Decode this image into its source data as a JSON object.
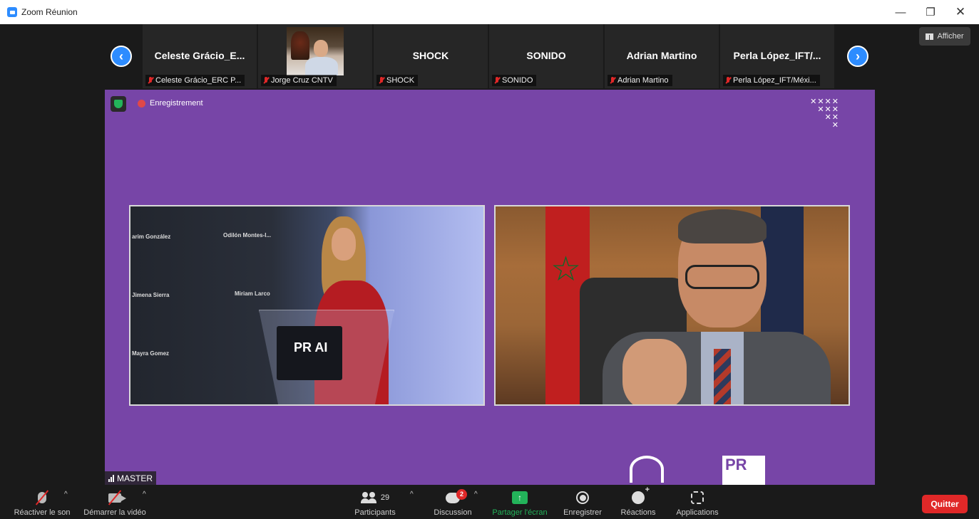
{
  "window": {
    "title": "Zoom Réunion"
  },
  "afficher_label": "Afficher",
  "thumbnails": [
    {
      "big": "Celeste Grácio_E...",
      "small": "Celeste Grácio_ERC P..."
    },
    {
      "big": "",
      "small": "Jorge Cruz CNTV"
    },
    {
      "big": "SHOCK",
      "small": "SHOCK"
    },
    {
      "big": "SONIDO",
      "small": "SONIDO"
    },
    {
      "big": "Adrian Martino",
      "small": "Adrian Martino"
    },
    {
      "big": "Perla López_IFT/...",
      "small": "Perla López_IFT/Méxi..."
    }
  ],
  "stage": {
    "recording_label": "Enregistrement",
    "master_label": "MASTER",
    "wall_names": [
      "arim González",
      "Odilón Montes-I...",
      "Jimena Sierra",
      "Miriam Larco",
      "Mayra Gomez"
    ],
    "podium_logo": "PR AI"
  },
  "toolbar": {
    "mic_label": "Réactiver le son",
    "video_label": "Démarrer la vidéo",
    "participants_label": "Participants",
    "participants_count": "29",
    "chat_label": "Discussion",
    "chat_badge": "2",
    "share_label": "Partager l'écran",
    "record_label": "Enregistrer",
    "reactions_label": "Réactions",
    "apps_label": "Applications",
    "quit_label": "Quitter"
  },
  "colors": {
    "stage_bg": "#7745a7",
    "accent_blue": "#2d8cff",
    "share_green": "#23b35a",
    "danger_red": "#e02828"
  }
}
